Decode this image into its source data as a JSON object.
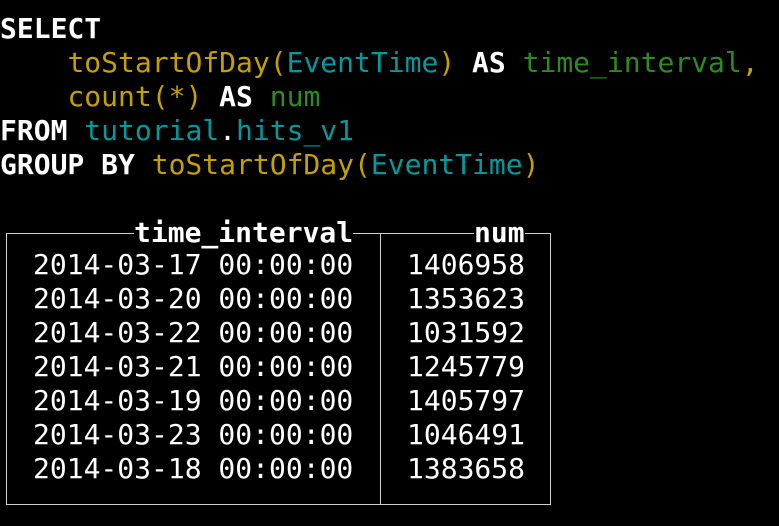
{
  "query": {
    "select_kw": "SELECT",
    "line1": {
      "fn": "toStartOfDay",
      "open": "(",
      "arg": "EventTime",
      "close": ")",
      "as_kw": "AS",
      "alias": "time_interval",
      "comma": ","
    },
    "line2": {
      "fn": "count",
      "args": "(*)",
      "as_kw": "AS",
      "alias": "num"
    },
    "from_kw": "FROM",
    "table_db": "tutorial",
    "dot": ".",
    "table_name": "hits_v1",
    "group_kw": "GROUP BY",
    "group": {
      "fn": "toStartOfDay",
      "open": "(",
      "arg": "EventTime",
      "close": ")"
    }
  },
  "result": {
    "columns": [
      "time_interval",
      "num"
    ],
    "rows": [
      [
        "2014-03-17 00:00:00",
        "1406958"
      ],
      [
        "2014-03-20 00:00:00",
        "1353623"
      ],
      [
        "2014-03-22 00:00:00",
        "1031592"
      ],
      [
        "2014-03-21 00:00:00",
        "1245779"
      ],
      [
        "2014-03-19 00:00:00",
        "1405797"
      ],
      [
        "2014-03-23 00:00:00",
        "1046491"
      ],
      [
        "2014-03-18 00:00:00",
        "1383658"
      ]
    ]
  },
  "colors": {
    "background": "#000000",
    "keyword": "#ffffff",
    "function": "#c4a000",
    "identifier": "#06989a",
    "alias": "#2e8b22",
    "border": "#d0d0d0"
  }
}
